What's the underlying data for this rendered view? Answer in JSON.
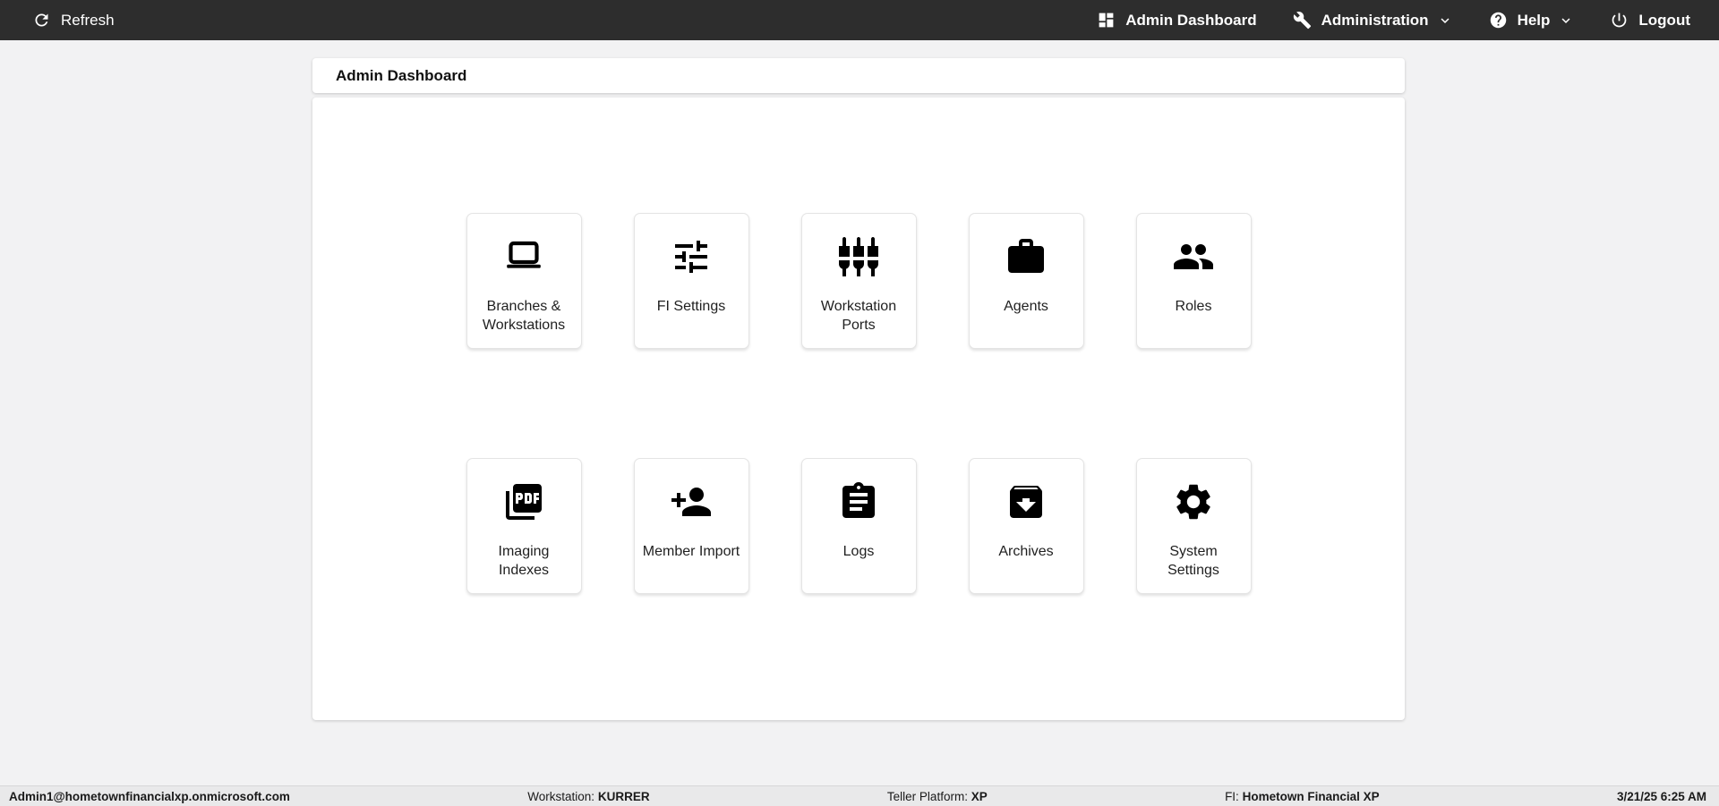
{
  "topbar": {
    "refresh_label": "Refresh",
    "nav_items": [
      {
        "label": "Admin Dashboard",
        "icon": "dashboard-icon",
        "has_chevron": false
      },
      {
        "label": "Administration",
        "icon": "wrench-icon",
        "has_chevron": true
      },
      {
        "label": "Help",
        "icon": "help-icon",
        "has_chevron": true
      },
      {
        "label": "Logout",
        "icon": "power-icon",
        "has_chevron": false
      }
    ]
  },
  "page": {
    "title": "Admin Dashboard"
  },
  "tiles": [
    {
      "label": "Branches & Workstations",
      "icon": "laptop-icon"
    },
    {
      "label": "FI Settings",
      "icon": "tune-sliders-icon"
    },
    {
      "label": "Workstation Ports",
      "icon": "input-component-icon"
    },
    {
      "label": "Agents",
      "icon": "briefcase-icon"
    },
    {
      "label": "Roles",
      "icon": "people-icon"
    },
    {
      "label": "Imaging Indexes",
      "icon": "pdf-icon"
    },
    {
      "label": "Member Import",
      "icon": "person-add-icon"
    },
    {
      "label": "Logs",
      "icon": "clipboard-icon"
    },
    {
      "label": "Archives",
      "icon": "archive-icon"
    },
    {
      "label": "System Settings",
      "icon": "gear-icon"
    }
  ],
  "statusbar": {
    "user": "Admin1@hometownfinancialxp.onmicrosoft.com",
    "workstation_label": "Workstation:",
    "workstation_value": "KURRER",
    "teller_platform_label": "Teller Platform:",
    "teller_platform_value": "XP",
    "fi_label": "FI:",
    "fi_value": "Hometown Financial XP",
    "datetime": "3/21/25 6:25 AM"
  },
  "colors": {
    "topbar_bg": "#2d2d2d",
    "topbar_text": "#ffffff",
    "page_bg": "#f2f2f3",
    "card_bg": "#ffffff",
    "statusbar_bg": "#e9e9ea",
    "icon_color": "#000000"
  }
}
